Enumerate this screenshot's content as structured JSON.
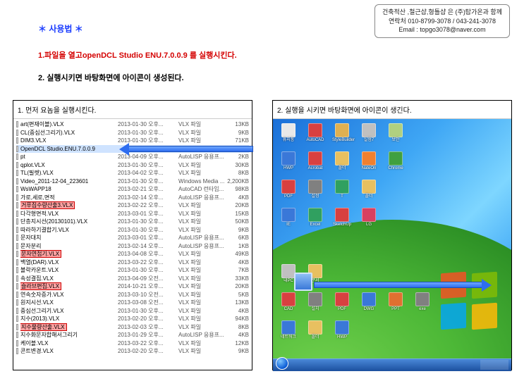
{
  "header": {
    "line1": "건축적산 ,철근샵,형틀샵 은 (주)탑가온과 함께",
    "line2": "연락처 010-8799-3078 / 043-241-3078",
    "line3": "Email : topgo3078@naver.com"
  },
  "title": "＊ 사용법 ＊",
  "step1": "1.파일을 열고openDCL Studio ENU.7.0.0.9 를 실행시킨다.",
  "step2": "2. 실행시키면 바탕화면에 아이콘이 생성된다.",
  "left_caption": "1. 먼저 요놈을 실행시킨다.",
  "right_caption": "2. 실행을 시키면 바탕화면에 아이콘이 생긴다.",
  "files": [
    {
      "name": "art(편재이블).VLX",
      "date": "2013-01-30 오후...",
      "type": "VLX 파일",
      "size": "13KB",
      "hi": ""
    },
    {
      "name": "CL(중심선그리기).VLX",
      "date": "2013-01-30 오후...",
      "type": "VLX 파일",
      "size": "9KB",
      "hi": ""
    },
    {
      "name": "DIM3.VLX",
      "date": "2013-01-30 오후...",
      "type": "VLX 파일",
      "size": "71KB",
      "hi": ""
    },
    {
      "name": "OpenDCL Studio.ENU.7.0.0.9",
      "date": "",
      "type": "",
      "size": "",
      "hi": "blue"
    },
    {
      "name": "pt",
      "date": "2013-04-09 오후...",
      "type": "AutoLISP 응용프...",
      "size": "2KB",
      "hi": ""
    },
    {
      "name": "qplot.VLX",
      "date": "2013-01-30 오후...",
      "type": "VLX 파일",
      "size": "30KB",
      "hi": ""
    },
    {
      "name": "TL(필렛).VLX",
      "date": "2013-04-02 오후...",
      "type": "VLX 파일",
      "size": "8KB",
      "hi": ""
    },
    {
      "name": "Video_2011-12-04_223601",
      "date": "2013-01-30 오후...",
      "type": "Windows Media ...",
      "size": "2,200KB",
      "hi": ""
    },
    {
      "name": "WsWAPP18",
      "date": "2013-02-21 오후...",
      "type": "AutoCAD 런타임...",
      "size": "98KB",
      "hi": ""
    },
    {
      "name": "가로,세로,면적",
      "date": "2013-02-14 오후...",
      "type": "AutoLISP 응용프...",
      "size": "4KB",
      "hi": ""
    },
    {
      "name": "거푸집수량산출3.VLX",
      "date": "2013-02-22 오후...",
      "type": "VLX 파일",
      "size": "20KB",
      "hi": "red"
    },
    {
      "name": "다각형면적.VLX",
      "date": "2013-03-01 오후...",
      "type": "VLX 파일",
      "size": "15KB",
      "hi": ""
    },
    {
      "name": "단층지시선(20130101).VLX",
      "date": "2013-01-30 오후...",
      "type": "VLX 파일",
      "size": "50KB",
      "hi": ""
    },
    {
      "name": "따라하기결합기.VLX",
      "date": "2013-01-30 오후...",
      "type": "VLX 파일",
      "size": "9KB",
      "hi": ""
    },
    {
      "name": "문자대치",
      "date": "2013-03-01 오후...",
      "type": "AutoLISP 응용프...",
      "size": "6KB",
      "hi": ""
    },
    {
      "name": "문자분리",
      "date": "2013-02-14 오후...",
      "type": "AutoLISP 응용프...",
      "size": "1KB",
      "hi": ""
    },
    {
      "name": "문자연접기.VLX",
      "date": "2013-04-08 오후...",
      "type": "VLX 파일",
      "size": "49KB",
      "hi": "red"
    },
    {
      "name": "백열(DAR).VLX",
      "date": "2013-03-22 오후...",
      "type": "VLX 파일",
      "size": "4KB",
      "hi": ""
    },
    {
      "name": "볼락카운트.VLX",
      "date": "2013-01-30 오후...",
      "type": "VLX 파일",
      "size": "7KB",
      "hi": ""
    },
    {
      "name": "속성결집.VLX",
      "date": "2013-04-09 오전...",
      "type": "VLX 파일",
      "size": "33KB",
      "hi": ""
    },
    {
      "name": "슬라브편집.VLX",
      "date": "2014-10-21 오후...",
      "type": "VLX 파일",
      "size": "20KB",
      "hi": "red"
    },
    {
      "name": "연속숫자증가.VLX",
      "date": "2013-03-10 오전...",
      "type": "VLX 파일",
      "size": "5KB",
      "hi": ""
    },
    {
      "name": "원지시선.VLX",
      "date": "2013-03-08 오전...",
      "type": "VLX 파일",
      "size": "13KB",
      "hi": ""
    },
    {
      "name": "중심선그리기.VLX",
      "date": "2013-01-30 오후...",
      "type": "VLX 파일",
      "size": "4KB",
      "hi": ""
    },
    {
      "name": "지수(2013).VLX",
      "date": "2013-02-20 오후...",
      "type": "VLX 파일",
      "size": "94KB",
      "hi": ""
    },
    {
      "name": "지수물량산출.VLX",
      "date": "2013-02-03 오후...",
      "type": "VLX 파일",
      "size": "8KB",
      "hi": "red"
    },
    {
      "name": "지수화문자합해서그리기",
      "date": "2013-01-29 오후...",
      "type": "AutoLISP 응용프...",
      "size": "4KB",
      "hi": ""
    },
    {
      "name": "케이블.VLX",
      "date": "2013-03-22 오후...",
      "type": "VLX 파일",
      "size": "12KB",
      "hi": ""
    },
    {
      "name": "콘트변경.VLX",
      "date": "2013-02-20 오후...",
      "type": "VLX 파일",
      "size": "9KB",
      "hi": ""
    }
  ],
  "desktop_icons": [
    {
      "row": 0,
      "col": 0,
      "label": "휴지통",
      "color": "#e8e8e8"
    },
    {
      "row": 0,
      "col": 1,
      "label": "AutoCAD",
      "color": "#d84040"
    },
    {
      "row": 0,
      "col": 2,
      "label": "StyleBuilder",
      "color": "#e0b050"
    },
    {
      "row": 0,
      "col": 3,
      "label": "실험7",
      "color": "#c0c0c0"
    },
    {
      "row": 0,
      "col": 4,
      "label": "보안",
      "color": "#b0d080"
    },
    {
      "row": 1,
      "col": 0,
      "label": "HWP",
      "color": "#3a78d8"
    },
    {
      "row": 1,
      "col": 1,
      "label": "Acrobat",
      "color": "#d84040"
    },
    {
      "row": 1,
      "col": 2,
      "label": "폴더",
      "color": "#e8c060"
    },
    {
      "row": 1,
      "col": 3,
      "label": "NateOn",
      "color": "#f08030"
    },
    {
      "row": 1,
      "col": 4,
      "label": "Chrome",
      "color": "#40a040"
    },
    {
      "row": 2,
      "col": 0,
      "label": "PDF",
      "color": "#d84040"
    },
    {
      "row": 2,
      "col": 1,
      "label": "설정",
      "color": "#808080"
    },
    {
      "row": 2,
      "col": 2,
      "label": "T",
      "color": "#30a060"
    },
    {
      "row": 2,
      "col": 3,
      "label": "폴더",
      "color": "#e8c060"
    },
    {
      "row": 3,
      "col": 0,
      "label": "IE",
      "color": "#3a78d8"
    },
    {
      "row": 3,
      "col": 1,
      "label": "Excel",
      "color": "#30a060"
    },
    {
      "row": 3,
      "col": 2,
      "label": "SketchUp",
      "color": "#d84040"
    },
    {
      "row": 3,
      "col": 3,
      "label": "LG",
      "color": "#d84060"
    },
    {
      "row": 5,
      "col": 0,
      "label": "내PC",
      "color": "#c0c0c0"
    },
    {
      "row": 5,
      "col": 1,
      "label": "문서",
      "color": "#e8c060"
    },
    {
      "row": 6,
      "col": 0,
      "label": "CAD",
      "color": "#d84040"
    },
    {
      "row": 6,
      "col": 1,
      "label": "설치",
      "color": "#808080"
    },
    {
      "row": 6,
      "col": 2,
      "label": "PDF",
      "color": "#d84040"
    },
    {
      "row": 6,
      "col": 3,
      "label": "DWG",
      "color": "#3a78d8"
    },
    {
      "row": 6,
      "col": 4,
      "label": "PPT",
      "color": "#e07030"
    },
    {
      "row": 6,
      "col": 5,
      "label": "exe",
      "color": "#808080"
    },
    {
      "row": 7,
      "col": 0,
      "label": "네트워크",
      "color": "#3a78d8"
    },
    {
      "row": 7,
      "col": 1,
      "label": "폴더",
      "color": "#e8c060"
    },
    {
      "row": 7,
      "col": 2,
      "label": "HWP",
      "color": "#3a78d8"
    }
  ]
}
